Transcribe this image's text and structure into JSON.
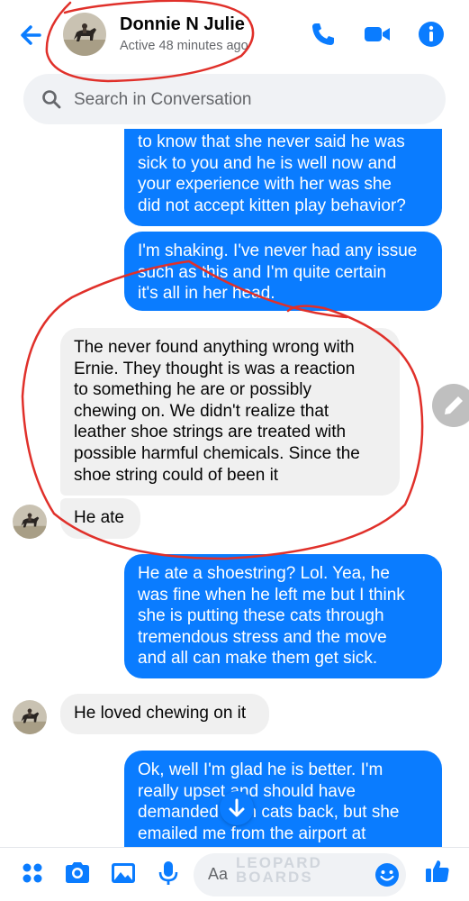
{
  "header": {
    "contact_name": "Donnie N Julie",
    "status": "Active 48 minutes ago",
    "accent_color": "#0a7cff"
  },
  "search": {
    "placeholder": "Search in Conversation"
  },
  "messages": [
    {
      "direction": "outgoing",
      "text": "to know that she never said he was\nsick to you and he is well now and\nyour experience with her was she\ndid not accept kitten play behavior?"
    },
    {
      "direction": "outgoing",
      "text": "I'm shaking. I've never had any issue\nsuch as this and I'm quite certain\nit's all in her head."
    },
    {
      "direction": "incoming",
      "text": "The never found anything wrong with\nErnie. They thought is was a reaction\nto something he are or possibly\nchewing on. We didn't realize that\nleather shoe strings are treated with\npossible harmful chemicals. Since the\nshoe string could of been it"
    },
    {
      "direction": "incoming",
      "text": "He ate"
    },
    {
      "direction": "outgoing",
      "text": "He ate a shoestring? Lol. Yea, he\nwas fine when he left me but I think\nshe is putting these cats through\ntremendous stress and the move\nand all can make them get sick."
    },
    {
      "direction": "incoming",
      "text": "He loved chewing on it"
    },
    {
      "direction": "outgoing",
      "text": "Ok, well I'm glad he is better. I'm\nreally upset and should have\ndemanded both cats back, but she\nemailed me from the airport at"
    }
  ],
  "composer": {
    "placeholder": "Aa"
  },
  "watermark": {
    "line1": "LEOPARD",
    "line2": "BOARDS"
  },
  "icons": {
    "back": "arrow-left-icon",
    "call": "phone-icon",
    "video": "video-camera-icon",
    "info": "info-icon",
    "search": "search-icon",
    "edit": "pencil-icon",
    "scroll": "arrow-down-icon",
    "apps": "four-dots-icon",
    "camera": "camera-icon",
    "gallery": "image-icon",
    "mic": "microphone-icon",
    "emoji": "smiley-icon",
    "like": "thumbs-up-icon"
  }
}
